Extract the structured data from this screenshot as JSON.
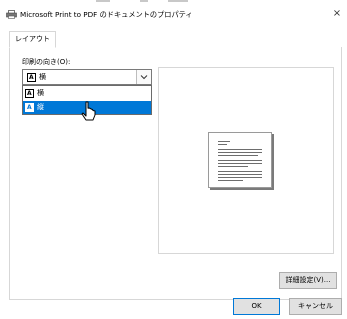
{
  "window": {
    "title": "Microsoft Print to PDF のドキュメントのプロパティ",
    "close_glyph": "×"
  },
  "tabs": [
    {
      "label": "レイアウト",
      "selected": true
    }
  ],
  "orientation": {
    "label": "印刷の向き(O):",
    "current_value": "横",
    "options": [
      {
        "label": "横",
        "highlighted": false
      },
      {
        "label": "縦",
        "highlighted": true
      }
    ],
    "icon_glyph": "A"
  },
  "buttons": {
    "advanced": "詳細設定(V)...",
    "ok": "OK",
    "cancel": "キャンセル"
  },
  "colors": {
    "accent": "#0078d7",
    "border": "#d7d7d7"
  },
  "icons": [
    "printer-icon",
    "close-icon",
    "orientation-icon",
    "chevron-down-icon",
    "mouse-cursor-icon",
    "page-preview-icon"
  ]
}
